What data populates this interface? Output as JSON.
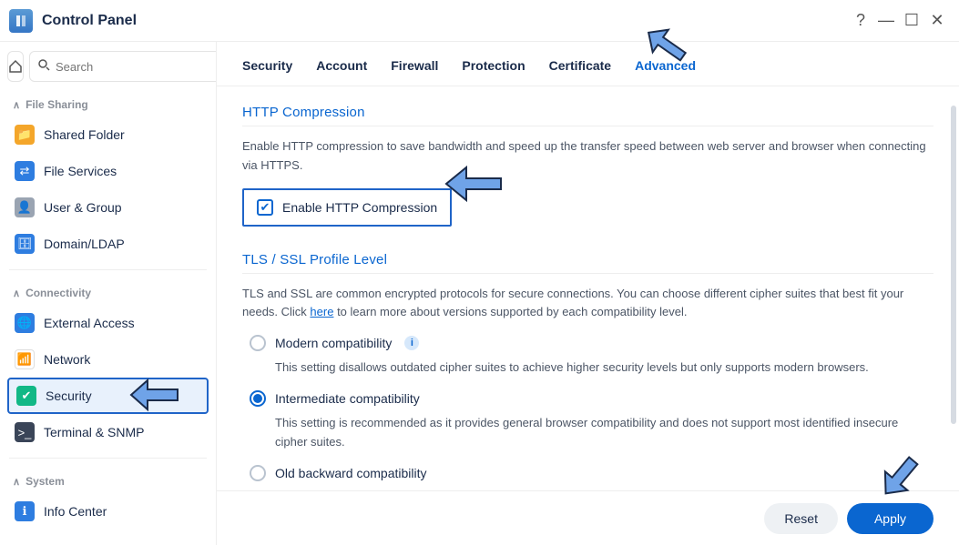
{
  "window": {
    "title": "Control Panel"
  },
  "search": {
    "placeholder": "Search"
  },
  "sidebar": {
    "sections": [
      {
        "label": "File Sharing"
      },
      {
        "label": "Connectivity"
      },
      {
        "label": "System"
      }
    ],
    "items": {
      "shared_folder": "Shared Folder",
      "file_services": "File Services",
      "user_group": "User & Group",
      "domain_ldap": "Domain/LDAP",
      "external_access": "External Access",
      "network": "Network",
      "security": "Security",
      "terminal_snmp": "Terminal & SNMP",
      "info_center": "Info Center"
    }
  },
  "tabs": {
    "security": "Security",
    "account": "Account",
    "firewall": "Firewall",
    "protection": "Protection",
    "certificate": "Certificate",
    "advanced": "Advanced"
  },
  "http_compression": {
    "title": "HTTP Compression",
    "desc": "Enable HTTP compression to save bandwidth and speed up the transfer speed between web server and browser when connecting via HTTPS.",
    "checkbox_label": "Enable HTTP Compression",
    "checked": true
  },
  "tls": {
    "title": "TLS / SSL Profile Level",
    "desc_pre": "TLS and SSL are common encrypted protocols for secure connections. You can choose different cipher suites that best fit your needs. Click ",
    "link": "here",
    "desc_post": " to learn more about versions supported by each compatibility level.",
    "options": [
      {
        "key": "modern",
        "label": "Modern compatibility",
        "desc": "This setting disallows outdated cipher suites to achieve higher security levels but only supports modern browsers.",
        "info": true
      },
      {
        "key": "intermediate",
        "label": "Intermediate compatibility",
        "desc": "This setting is recommended as it provides general browser compatibility and does not support most identified insecure cipher suites."
      },
      {
        "key": "old",
        "label": "Old backward compatibility"
      }
    ],
    "selected": "intermediate"
  },
  "buttons": {
    "reset": "Reset",
    "apply": "Apply"
  }
}
